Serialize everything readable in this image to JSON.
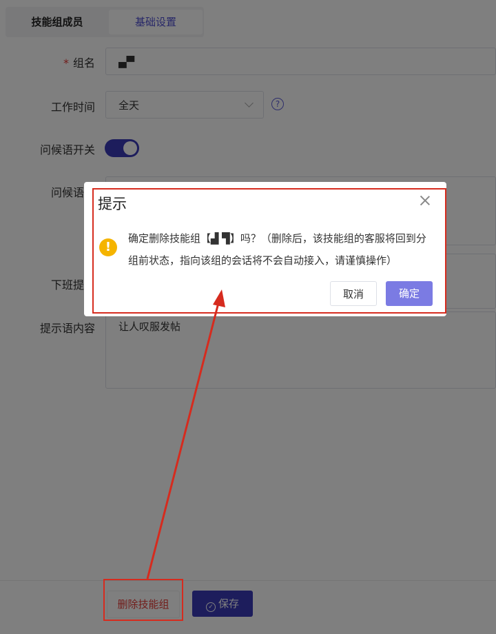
{
  "tabs": [
    {
      "label": "技能组成员"
    },
    {
      "label": "基础设置"
    }
  ],
  "form": {
    "group_name": {
      "required_mark": "*",
      "label": "组名",
      "value": "▄▀"
    },
    "work_time": {
      "label": "工作时间",
      "value": "全天",
      "help": "?"
    },
    "greeting_switch": {
      "label": "问候语开关"
    },
    "greeting_msg": {
      "label": "问候语消"
    },
    "off_duty_tip": {
      "label": "下班提示"
    },
    "tip_content": {
      "label": "提示语内容",
      "value": "让人叹服发帖"
    }
  },
  "footer": {
    "delete_label": "删除技能组",
    "save_label": "保存"
  },
  "dialog": {
    "title": "提示",
    "message": "确定删除技能组【▟ ▜】吗？（删除后，该技能组的客服将回到分组前状态，指向该组的会话将不会自动接入，请谨慎操作）",
    "cancel_label": "取消",
    "ok_label": "确定"
  },
  "colors": {
    "primary": "#3a3ab8",
    "confirm": "#7b7be3",
    "warning": "#f5b400",
    "annotation": "#d62b1e"
  }
}
